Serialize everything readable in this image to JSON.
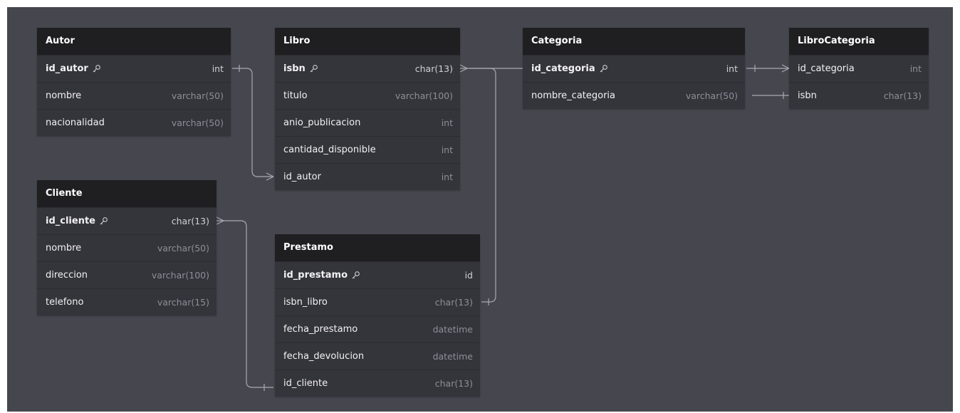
{
  "tables": {
    "autor": {
      "name": "Autor",
      "fields": [
        {
          "name": "id_autor",
          "type": "int",
          "pk": true
        },
        {
          "name": "nombre",
          "type": "varchar(50)"
        },
        {
          "name": "nacionalidad",
          "type": "varchar(50)"
        }
      ]
    },
    "libro": {
      "name": "Libro",
      "fields": [
        {
          "name": "isbn",
          "type": "char(13)",
          "pk": true
        },
        {
          "name": "titulo",
          "type": "varchar(100)"
        },
        {
          "name": "anio_publicacion",
          "type": "int"
        },
        {
          "name": "cantidad_disponible",
          "type": "int"
        },
        {
          "name": "id_autor",
          "type": "int"
        }
      ]
    },
    "categoria": {
      "name": "Categoria",
      "fields": [
        {
          "name": "id_categoria",
          "type": "int",
          "pk": true
        },
        {
          "name": "nombre_categoria",
          "type": "varchar(50)"
        }
      ]
    },
    "librocategoria": {
      "name": "LibroCategoria",
      "fields": [
        {
          "name": "id_categoria",
          "type": "int"
        },
        {
          "name": "isbn",
          "type": "char(13)"
        }
      ]
    },
    "cliente": {
      "name": "Cliente",
      "fields": [
        {
          "name": "id_cliente",
          "type": "char(13)",
          "pk": true
        },
        {
          "name": "nombre",
          "type": "varchar(50)"
        },
        {
          "name": "direccion",
          "type": "varchar(100)"
        },
        {
          "name": "telefono",
          "type": "varchar(15)"
        }
      ]
    },
    "prestamo": {
      "name": "Prestamo",
      "fields": [
        {
          "name": "id_prestamo",
          "type": "id",
          "pk": true
        },
        {
          "name": "isbn_libro",
          "type": "char(13)"
        },
        {
          "name": "fecha_prestamo",
          "type": "datetime"
        },
        {
          "name": "fecha_devolucion",
          "type": "datetime"
        },
        {
          "name": "id_cliente",
          "type": "char(13)"
        }
      ]
    }
  },
  "relationships": [
    {
      "from": "Autor.id_autor",
      "to": "Libro.id_autor",
      "cardinality": "one-to-many"
    },
    {
      "from": "Libro.isbn",
      "to": "Prestamo.isbn_libro",
      "cardinality": "many-to-one"
    },
    {
      "from": "Cliente.id_cliente",
      "to": "Prestamo.id_cliente",
      "cardinality": "many-to-one"
    },
    {
      "from": "Categoria.id_categoria",
      "to": "LibroCategoria.id_categoria",
      "cardinality": "one-to-many"
    },
    {
      "from": "Categoria.nombre_categoria",
      "to": "LibroCategoria.isbn",
      "cardinality": "one-to-one"
    },
    {
      "from": "Libro.isbn",
      "to": "Categoria.id_categoria",
      "cardinality": "many-to-one"
    }
  ],
  "colors": {
    "canvas": "#46464f",
    "table_body": "#34343b",
    "table_header": "#1f1f22",
    "edge": "#a9a9b2"
  }
}
